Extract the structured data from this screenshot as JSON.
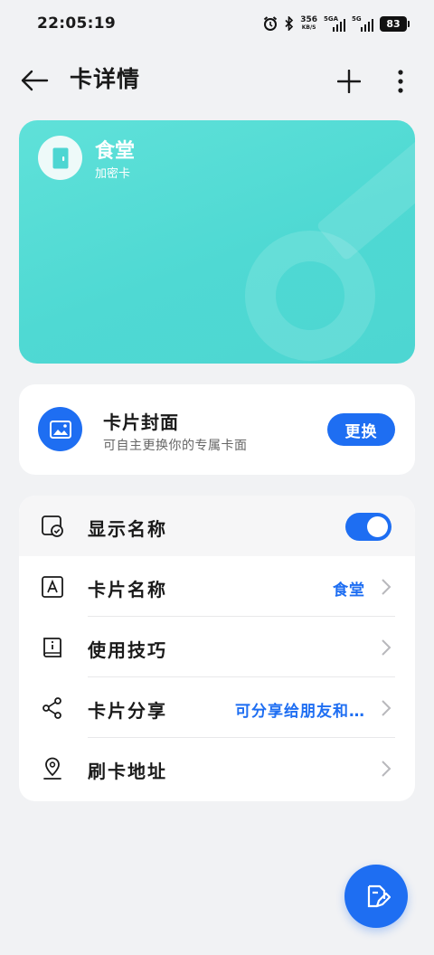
{
  "status_bar": {
    "time": "22:05:19",
    "net_speed_value": "356",
    "net_speed_unit": "KB/S",
    "sim1_label": "5GA",
    "sim2_label": "5G",
    "battery": "83",
    "icons": [
      "alarm-icon",
      "bluetooth-icon",
      "signal-icon",
      "signal-icon",
      "battery-icon"
    ]
  },
  "header": {
    "title": "卡详情"
  },
  "card": {
    "name": "食堂",
    "type": "加密卡",
    "background_color": "#4fd9d3"
  },
  "cover": {
    "title": "卡片封面",
    "description": "可自主更换你的专属卡面",
    "button_label": "更换"
  },
  "settings": {
    "rows": [
      {
        "label": "显示名称",
        "icon": "display-name-icon",
        "toggle_on": true
      },
      {
        "label": "卡片名称",
        "icon": "letter-a-icon",
        "value": "食堂"
      },
      {
        "label": "使用技巧",
        "icon": "info-book-icon"
      },
      {
        "label": "卡片分享",
        "icon": "share-icon",
        "value": "可分享给朋友和…"
      },
      {
        "label": "刷卡地址",
        "icon": "location-icon"
      }
    ]
  },
  "colors": {
    "accent": "#1e6ef2",
    "card": "#4fd9d3",
    "background": "#f1f2f4"
  }
}
